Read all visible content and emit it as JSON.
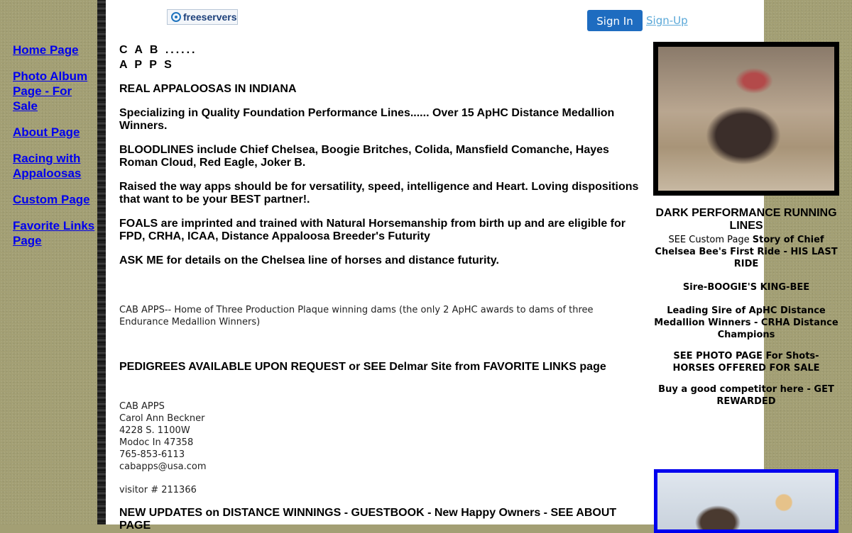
{
  "header": {
    "logo_text": "freeservers",
    "signin_label": "Sign In",
    "signup_label": "Sign-Up"
  },
  "nav": {
    "items": [
      {
        "label": "Home Page"
      },
      {
        "label": "Photo Album Page - For Sale"
      },
      {
        "label": "About Page"
      },
      {
        "label": "Racing with Appaloosas"
      },
      {
        "label": "Custom Page"
      },
      {
        "label": "Favorite Links Page"
      }
    ]
  },
  "main": {
    "title_line1": "C A B ......",
    "title_line2": "A P P S",
    "heading": "REAL APPALOOSAS IN INDIANA",
    "para1": "Specializing in Quality Foundation Performance Lines...... Over 15 ApHC Distance Medallion Winners.",
    "para2": "BLOODLINES include Chief Chelsea, Boogie Britches, Colida, Mansfield Comanche, Hayes Roman Cloud, Red Eagle, Joker B.",
    "para3": "Raised the way apps should be for versatility, speed, intelligence and Heart. Loving dispositions that want to be your BEST partner!.",
    "para4": "FOALS are imprinted and trained with Natural Horsemanship from birth up and are eligible for FPD, CRHA, ICAA, Distance Appaloosa Breeder's Futurity",
    "para5": "ASK ME for details on the Chelsea line of horses and distance futurity.",
    "plaque_text": "CAB APPS-- Home of Three Production Plaque winning dams (the only 2 ApHC awards to dams of three Endurance Medallion Winners)",
    "pedigrees": "PEDIGREES AVAILABLE UPON REQUEST or SEE Delmar Site from FAVORITE LINKS page",
    "contact": {
      "name1": "CAB APPS",
      "name2": "Carol Ann Beckner",
      "address": "4228 S. 1100W",
      "city": "Modoc In 47358",
      "phone": "765-853-6113",
      "email": "cabapps@usa.com"
    },
    "visitor": "visitor # 211366",
    "updates": "NEW UPDATES on DISTANCE WINNINGS - GUESTBOOK - New Happy Owners - SEE ABOUT PAGE"
  },
  "right": {
    "heading": "DARK PERFORMANCE RUNNING LINES",
    "see_custom_prefix": "SEE Custom Page ",
    "see_custom_bold": "Story of Chief Chelsea Bee's First Ride - HIS LAST RIDE",
    "sire": "Sire-BOOGIE'S KING-BEE",
    "leading_sire": "Leading Sire of ApHC Distance Medallion Winners - CRHA Distance Champions",
    "photo_page": "SEE PHOTO PAGE For Shots- HORSES OFFERED FOR SALE",
    "buy": "Buy a good competitor here - GET REWARDED"
  },
  "colors": {
    "background": "#a39f74",
    "link": "#0000ee",
    "signin": "#1e6cc0"
  }
}
